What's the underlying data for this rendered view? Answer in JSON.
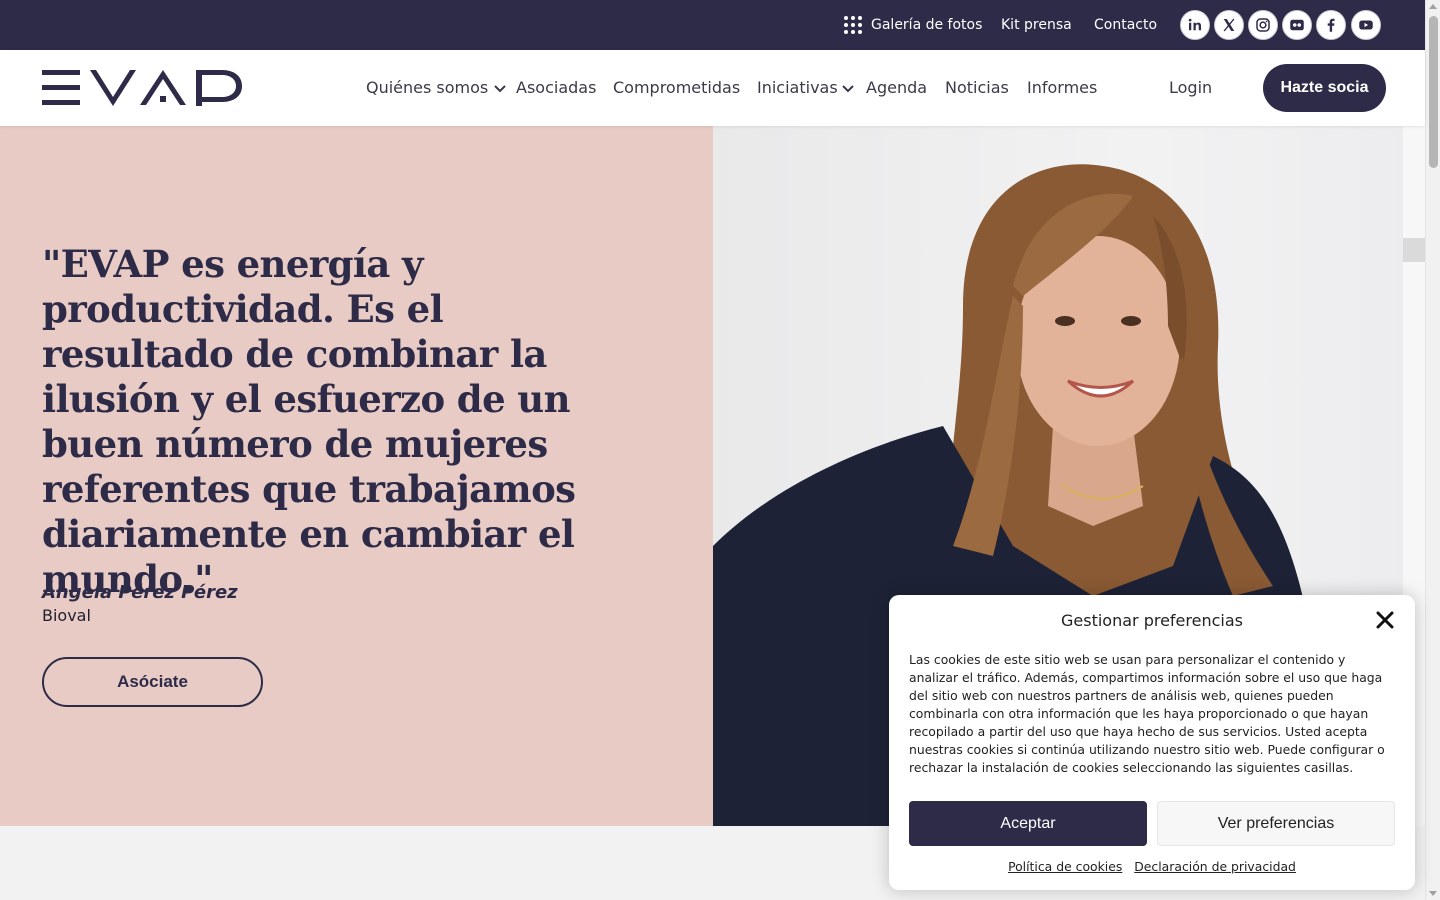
{
  "topbar": {
    "gallery_label": "Galería de fotos",
    "press_label": "Kit prensa",
    "contact_label": "Contacto",
    "social": [
      "linkedin-icon",
      "x-icon",
      "instagram-icon",
      "flickr-icon",
      "facebook-icon",
      "youtube-icon"
    ]
  },
  "header": {
    "nav": {
      "quienes": "Quiénes somos",
      "asociadas": "Asociadas",
      "comprometidas": "Comprometidas",
      "iniciativas": "Iniciativas",
      "agenda": "Agenda",
      "noticias": "Noticias",
      "informes": "Informes"
    },
    "login_label": "Login",
    "cta_label": "Hazte socia"
  },
  "hero": {
    "quote": "\"EVAP es energía y productividad. Es el resultado de combinar la ilusión y el esfuerzo de un buen número de mujeres referentes que trabajamos diariamente en cambiar el mundo.\"",
    "author": "Ángela Pérez Pérez",
    "company": "Bioval",
    "button_label": "Asóciate"
  },
  "cookie": {
    "title": "Gestionar preferencias",
    "body": "Las cookies de este sitio web se usan para personalizar el contenido y analizar el tráfico. Además, compartimos información sobre el uso que haga del sitio web con nuestros partners de análisis web, quienes pueden combinarla con otra información que les haya proporcionado o que hayan recopilado a partir del uso que haya hecho de sus servicios. Usted acepta nuestras cookies si continúa utilizando nuestro sitio web. Puede configurar o rechazar la instalación de cookies seleccionando las siguientes casillas.",
    "accept_label": "Aceptar",
    "prefs_label": "Ver preferencias",
    "cookie_policy": "Política de cookies",
    "privacy": "Declaración de privacidad"
  },
  "colors": {
    "navy": "#2d2b48",
    "pink": "#e8cbc4"
  }
}
